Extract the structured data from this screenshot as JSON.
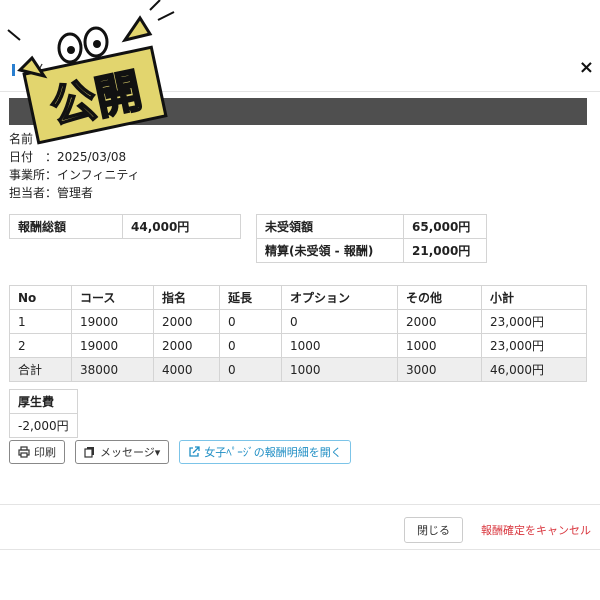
{
  "header": {
    "title": "さん",
    "close_icon": "×"
  },
  "info": {
    "name_label": "名前",
    "date": "日付　：2025/03/08",
    "office": "事業所：インフィニティ",
    "person": "担当者：管理者"
  },
  "summary": {
    "total_reward_label": "報酬総額",
    "total_reward_value": "44,000円",
    "unreceived_label": "未受領額",
    "unreceived_value": "65,000円",
    "settlement_label": "精算(未受領 - 報酬)",
    "settlement_value": "21,000円"
  },
  "table": {
    "headers": [
      "No",
      "コース",
      "指名",
      "延長",
      "オプション",
      "その他",
      "小計"
    ],
    "rows": [
      [
        "1",
        "19000",
        "2000",
        "0",
        "0",
        "2000",
        "23,000円"
      ],
      [
        "2",
        "19000",
        "2000",
        "0",
        "1000",
        "1000",
        "23,000円"
      ]
    ],
    "total": [
      "合計",
      "38000",
      "4000",
      "0",
      "1000",
      "3000",
      "46,000円"
    ]
  },
  "welfare": {
    "label": "厚生費",
    "value": "-2,000円"
  },
  "actions": {
    "print": "印刷",
    "message": "メッセージ▾",
    "open_detail": "女子ﾍﾟｰｼﾞの報酬明細を開く"
  },
  "footer": {
    "close": "閉じる",
    "cancel": "報酬確定をキャンセル"
  },
  "overlay": {
    "sticker_text": "公開",
    "sticker_icon": "cartoon-sticker-icon"
  }
}
